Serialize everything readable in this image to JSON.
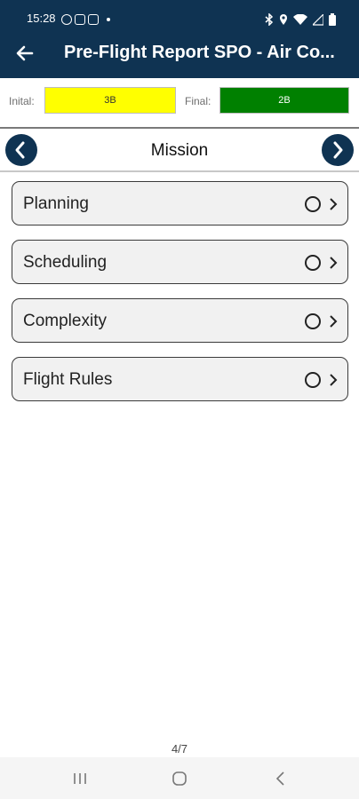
{
  "status_bar": {
    "time": "15:28",
    "left_icons": [
      "whatsapp-icon",
      "gallery-icon",
      "instagram-icon",
      "dot-icon"
    ],
    "right_icons": [
      "bluetooth-icon",
      "location-icon",
      "wifi-icon",
      "signal-icon",
      "battery-icon"
    ]
  },
  "app_bar": {
    "title": "Pre-Flight Report SPO - Air Co...",
    "back_icon": "arrow-left-icon",
    "color": "#0f3352"
  },
  "ratings": {
    "initial_label": "Inital:",
    "initial_value": "3B",
    "initial_color": "#ffff00",
    "final_label": "Final:",
    "final_value": "2B",
    "final_color": "#008000"
  },
  "section": {
    "title": "Mission",
    "prev_icon": "chevron-left-circle-icon",
    "next_icon": "chevron-right-circle-icon"
  },
  "items": [
    {
      "label": "Planning"
    },
    {
      "label": "Scheduling"
    },
    {
      "label": "Complexity"
    },
    {
      "label": "Flight Rules"
    }
  ],
  "pager": "4/7",
  "system_nav": [
    "recents-icon",
    "home-icon",
    "back-icon"
  ]
}
